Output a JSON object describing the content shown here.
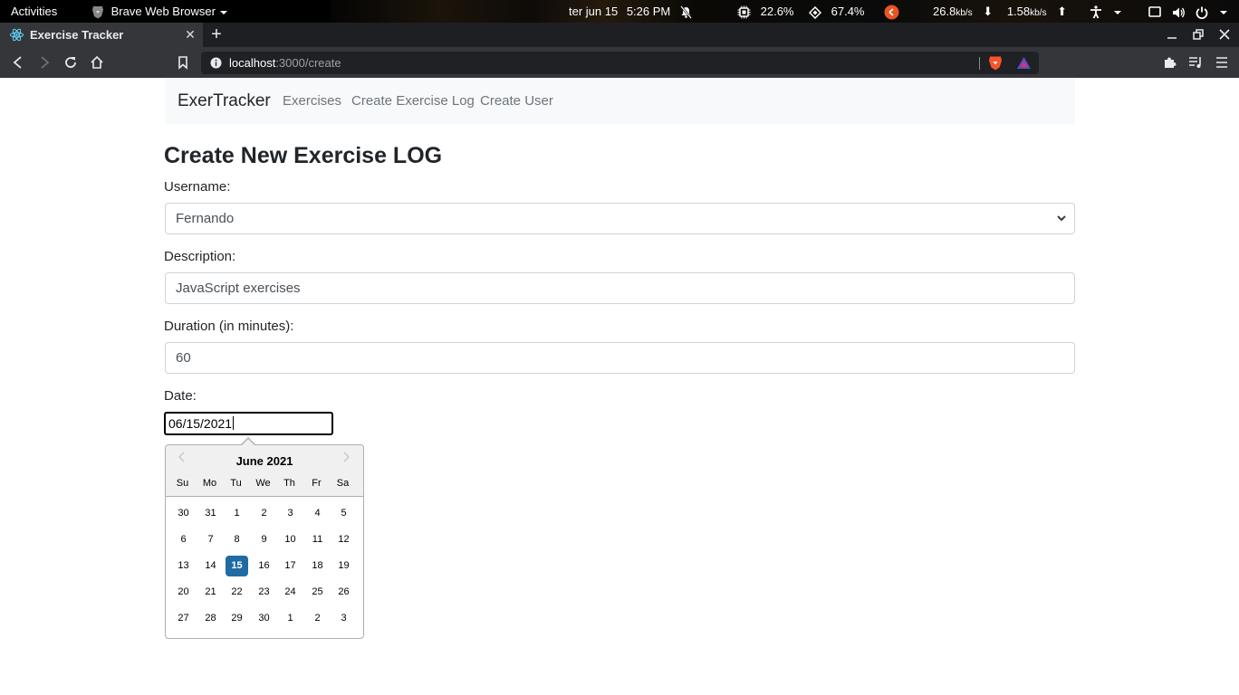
{
  "system_bar": {
    "activities": "Activities",
    "app_name": "Brave Web Browser",
    "date": "ter jun 15",
    "time": "5:26 PM",
    "cpu": "22.6%",
    "mem": "67.4%",
    "down_speed": "26.8",
    "down_unit": "kb/s",
    "up_speed": "1.58",
    "up_unit": "kb/s"
  },
  "browser": {
    "tab_title": "Exercise Tracker",
    "url_host": "localhost",
    "url_rest": ":3000/create"
  },
  "navbar": {
    "brand": "ExerTracker",
    "links": [
      "Exercises",
      "Create Exercise Log",
      "Create User"
    ]
  },
  "form": {
    "heading": "Create New Exercise LOG",
    "username_label": "Username:",
    "username_value": "Fernando",
    "description_label": "Description:",
    "description_value": "JavaScript exercises",
    "duration_label": "Duration (in minutes):",
    "duration_value": "60",
    "date_label": "Date:",
    "date_value": "06/15/2021"
  },
  "datepicker": {
    "month_label": "June 2021",
    "weekdays": [
      "Su",
      "Mo",
      "Tu",
      "We",
      "Th",
      "Fr",
      "Sa"
    ],
    "weeks": [
      [
        "30",
        "31",
        "1",
        "2",
        "3",
        "4",
        "5"
      ],
      [
        "6",
        "7",
        "8",
        "9",
        "10",
        "11",
        "12"
      ],
      [
        "13",
        "14",
        "15",
        "16",
        "17",
        "18",
        "19"
      ],
      [
        "20",
        "21",
        "22",
        "23",
        "24",
        "25",
        "26"
      ],
      [
        "27",
        "28",
        "29",
        "30",
        "1",
        "2",
        "3"
      ]
    ],
    "selected_day": "15",
    "selected_color": "#216ba5"
  }
}
